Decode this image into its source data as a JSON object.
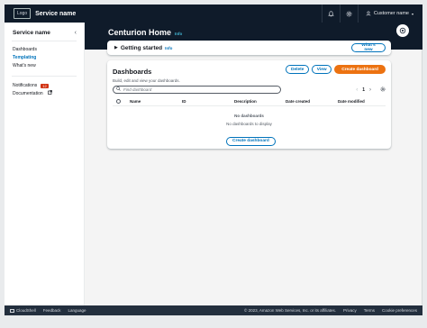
{
  "topnav": {
    "logo": "Logo",
    "service_name": "Service name",
    "notification_icon": "bell-icon",
    "settings_icon": "gear-icon",
    "user_icon": "user-icon",
    "user_name": "Customer name"
  },
  "sidenav": {
    "title": "Service name",
    "items": [
      {
        "label": "Dashboards",
        "active": false
      },
      {
        "label": "Templating",
        "active": true
      },
      {
        "label": "What's new",
        "active": false
      }
    ],
    "notifications_label": "Notifications",
    "notifications_count": "12",
    "documentation_label": "Documentation"
  },
  "page": {
    "title": "Centurion Home",
    "info": "Info"
  },
  "getting_started": {
    "title": "Getting started",
    "info": "Info",
    "whats_new_button": "What's new"
  },
  "dashboards": {
    "title": "Dashboards",
    "description": "Build, edit and view your dashboards.",
    "delete_button": "Delete",
    "view_button": "View",
    "create_button": "Create dashboard",
    "search_placeholder": "Find dashboard",
    "current_page": "1",
    "columns": [
      "Name",
      "ID",
      "Description",
      "Date created",
      "Date modified"
    ],
    "empty_title": "No dashboards",
    "empty_description": "No dashboards to display",
    "empty_create_button": "Create dashboard"
  },
  "footer": {
    "cloudshell": "CloudShell",
    "feedback": "Feedback",
    "language": "Language",
    "copyright": "© 2023, Amazon Web Services, Inc. or its affiliates.",
    "privacy": "Privacy",
    "terms": "Terms",
    "cookie": "Cookie preferences"
  },
  "colors": {
    "nav_bg": "#0f1b2a",
    "link": "#0073bb",
    "primary": "#ec7211",
    "badge": "#d13212"
  }
}
